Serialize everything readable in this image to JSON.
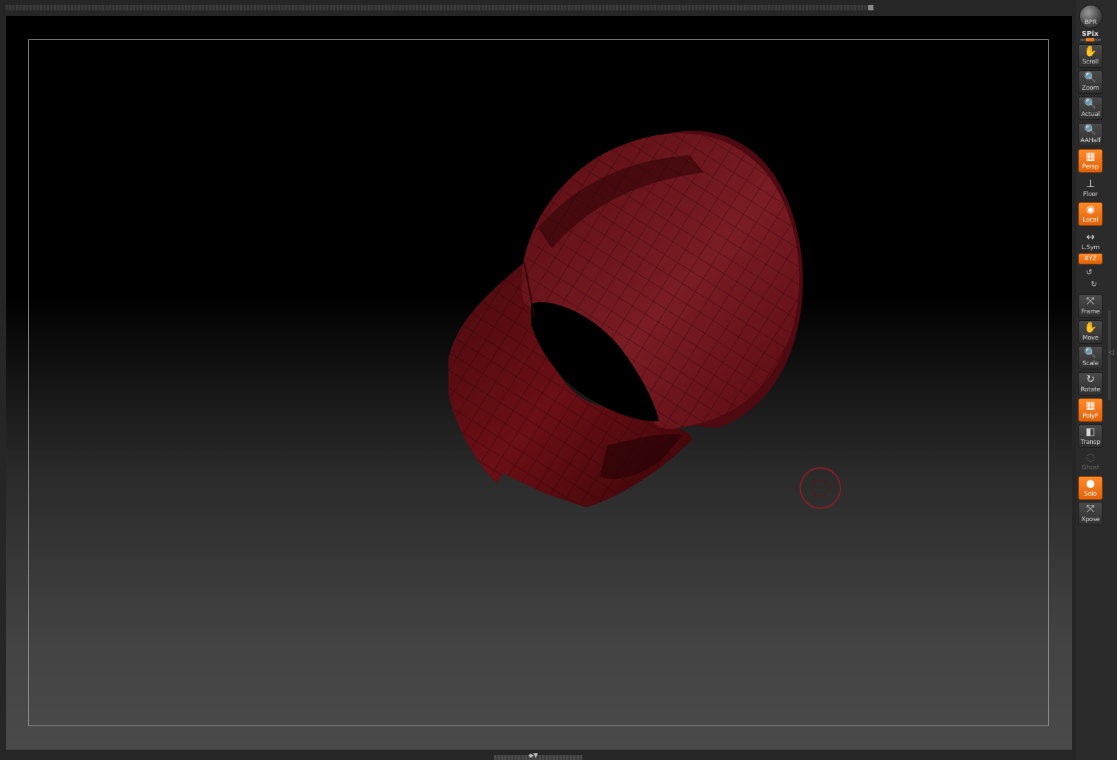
{
  "right_shelf": {
    "bpr": {
      "label": "BPR",
      "icon": "render-sphere-icon"
    },
    "spix": {
      "label": "SPix",
      "level": 0.4
    },
    "tools": [
      {
        "key": "scroll",
        "label": "Scroll",
        "icon": "hand-scroll-icon",
        "glyph": "✋",
        "active": false
      },
      {
        "key": "zoom",
        "label": "Zoom",
        "icon": "magnifier-zoom-icon",
        "glyph": "🔍",
        "active": false
      },
      {
        "key": "actual",
        "label": "Actual",
        "icon": "magnifier-actual-icon",
        "glyph": "🔍",
        "active": false
      },
      {
        "key": "aahalf",
        "label": "AAHalf",
        "icon": "magnifier-aahalf-icon",
        "glyph": "🔍",
        "active": false
      },
      {
        "key": "persp",
        "label": "Persp",
        "icon": "perspective-grid-icon",
        "glyph": "▦",
        "active": true
      },
      {
        "key": "floor",
        "label": "Floor",
        "icon": "floor-icon",
        "glyph": "⊥",
        "active": false
      },
      {
        "key": "local",
        "label": "Local",
        "icon": "local-transform-icon",
        "glyph": "◉",
        "active": true
      },
      {
        "key": "lsym",
        "label": "L.Sym",
        "icon": "local-symmetry-icon",
        "glyph": "↔",
        "active": false
      },
      {
        "key": "frame",
        "label": "Frame",
        "icon": "frame-icon",
        "glyph": "⤧",
        "active": false
      },
      {
        "key": "move",
        "label": "Move",
        "icon": "hand-move-icon",
        "glyph": "✋",
        "active": false
      },
      {
        "key": "scale",
        "label": "Scale",
        "icon": "magnifier-scale-icon",
        "glyph": "🔍",
        "active": false
      },
      {
        "key": "rotate",
        "label": "Rotate",
        "icon": "rotate-icon",
        "glyph": "↻",
        "active": false
      },
      {
        "key": "polyf",
        "label": "PolyF",
        "icon": "polyframe-grid-icon",
        "glyph": "▦",
        "active": true
      },
      {
        "key": "transp",
        "label": "Transp",
        "icon": "transparency-icon",
        "glyph": "◧",
        "active": false
      },
      {
        "key": "ghost",
        "label": "Ghost",
        "icon": "ghost-icon",
        "glyph": "◌",
        "active": false,
        "disabled": true
      },
      {
        "key": "solo",
        "label": "Solo",
        "icon": "solo-icon",
        "glyph": "●",
        "active": true
      },
      {
        "key": "xpose",
        "label": "Xpose",
        "icon": "xpose-icon",
        "glyph": "⤧",
        "active": false
      }
    ],
    "xyz": {
      "label": "XYZ",
      "active": true,
      "icon": "xyz-rotate-icon"
    }
  },
  "canvas": {
    "model_color": "#6b0d12",
    "background_top": "#000000",
    "background_bottom": "#4a4a4a",
    "brush_cursor_color": "#b0151c"
  },
  "colors": {
    "accent": "#f07a1e",
    "panel": "#262626"
  }
}
